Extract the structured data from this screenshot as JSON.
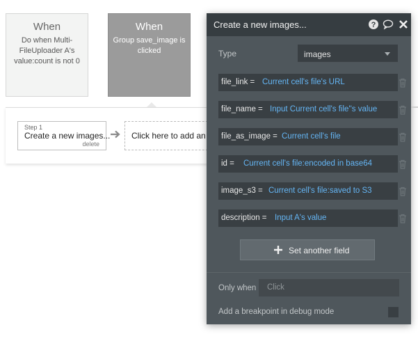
{
  "events": [
    {
      "title": "When",
      "description": "Do when Multi-FileUploader A's value:count is not 0"
    },
    {
      "title": "When",
      "description": "Group save_image is clicked"
    }
  ],
  "steps": {
    "step_label": "Step 1",
    "step_name": "Create a new images...",
    "delete_label": "delete",
    "add_action_label": "Click here to add an action..."
  },
  "panel": {
    "title": "Create a new images...",
    "type_label": "Type",
    "type_value": "images",
    "fields": [
      {
        "name": "file_link =",
        "value": "Current cell's file's URL"
      },
      {
        "name": "file_name =",
        "value": "Input Current cell's file''s value"
      },
      {
        "name": "file_as_image =",
        "value": "Current cell's file"
      },
      {
        "name": "id =",
        "value": "Current cell's file:encoded in base64"
      },
      {
        "name": "image_s3 =",
        "value": "Current cell's file:saved to S3"
      },
      {
        "name": "description =",
        "value": "Input A's value"
      }
    ],
    "set_another_field": "Set another field",
    "only_when_label": "Only when",
    "only_when_placeholder": "Click",
    "breakpoint_label": "Add a breakpoint in debug mode"
  },
  "icons": [
    "help-icon",
    "comment-icon",
    "close-icon",
    "arrow-right-icon",
    "trash-icon",
    "plus-icon",
    "chevron-down-icon"
  ],
  "colors": {
    "panel_bg": "#4f575c",
    "header_bg": "#363d41",
    "dynamic_value": "#65b6f5",
    "selected_event": "#9b9b9b"
  }
}
